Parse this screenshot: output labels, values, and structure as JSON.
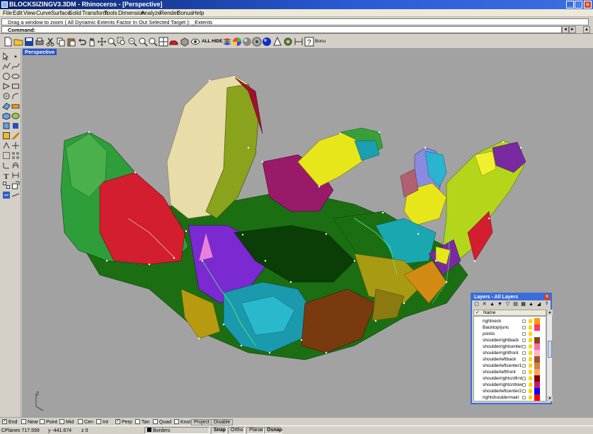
{
  "window": {
    "title": "BLOCKSIZINGV3.3DM - Rhinoceros - [Perspective]",
    "controls": [
      "_",
      "□",
      "×"
    ]
  },
  "menu": [
    "File",
    "Edit",
    "View",
    "Curve",
    "Surface",
    "Solid",
    "Transform",
    "Tools",
    "Dimension",
    "Analyze",
    "Render",
    "Bonus",
    "Help"
  ],
  "command": {
    "history": "Drag a window to zoom ( All  Dynamic  Extents  Factor  In  Out  Selected  Target ): _Extents",
    "prompt": "Command:",
    "arrows": [
      "◄",
      "►",
      "▲"
    ]
  },
  "toolbar": {
    "all_label": "ALL",
    "hide_label": "HIDE",
    "bonus_label": "Bonu"
  },
  "viewport": {
    "label": "Perspective",
    "background": "#a2a2a2",
    "axis_z": "Z"
  },
  "layers": {
    "title": "Layers - All Layers",
    "close": "×",
    "column_check": "✓",
    "column_name": "Name",
    "rows": [
      {
        "name": "rightneck",
        "color": "#ff9900"
      },
      {
        "name": "Backtop/junc",
        "color": "#ff3366"
      },
      {
        "name": "points",
        "color": "#ffffff"
      },
      {
        "name": "shoulderrightback",
        "color": "#8b4513"
      },
      {
        "name": "shoulderrightcenter",
        "color": "#ff69b4"
      },
      {
        "name": "shoulderrightfront",
        "color": "#ffb6c1"
      },
      {
        "name": "shoulderleftback",
        "color": "#a0522d"
      },
      {
        "name": "shoulderleftcenter1",
        "color": "#cd853f"
      },
      {
        "name": "shoulderleftfront",
        "color": "#f4a460"
      },
      {
        "name": "shoulderrightcntfrnt",
        "color": "#800000"
      },
      {
        "name": "shoulderrightcntlowr",
        "color": "#c71585"
      },
      {
        "name": "shoulderleftcenter2",
        "color": "#0000ff"
      },
      {
        "name": "rightshouldermain",
        "color": "#ff0000"
      }
    ]
  },
  "osnap": {
    "items": [
      {
        "label": "End",
        "checked": true
      },
      {
        "label": "Near",
        "checked": false
      },
      {
        "label": "Point",
        "checked": false
      },
      {
        "label": "Mid",
        "checked": false
      },
      {
        "label": "Cen",
        "checked": false
      },
      {
        "label": "Int",
        "checked": false
      },
      {
        "label": "Perp",
        "checked": true
      },
      {
        "label": "Tan",
        "checked": false
      },
      {
        "label": "Quad",
        "checked": false
      },
      {
        "label": "Knot",
        "checked": false
      }
    ],
    "project": "Project",
    "disable": "Disable"
  },
  "status": {
    "cplane": "CPlane",
    "x": "x 717.599",
    "y": "y -441.674",
    "z": "z 0",
    "layer": "Borders",
    "layer_color": "#000000",
    "snap": "Snap",
    "ortho": "Ortho",
    "planar": "Planar",
    "osnap": "Osnap"
  }
}
